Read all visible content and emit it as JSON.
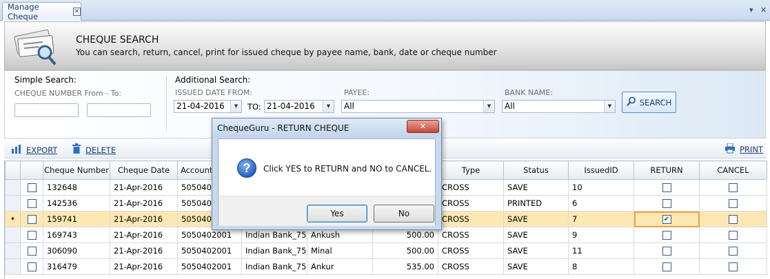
{
  "tab": {
    "title": "Manage Cheque",
    "close_glyph": "✕"
  },
  "window_controls": {
    "dropdown": "▾",
    "close": "✕"
  },
  "header": {
    "title": "CHEQUE SEARCH",
    "subtitle": "You can search, return, cancel, print for issued cheque by payee name, bank, date or cheque number",
    "icon": "cheque-search-icon"
  },
  "search": {
    "simple_label": "Simple Search:",
    "cheque_range_label": "CHEQUE NUMBER From - To:",
    "cheque_from": "",
    "cheque_to": "",
    "additional_label": "Additional Search:",
    "issued_from_label": "ISSUED DATE FROM:",
    "issued_from": "21-04-2016",
    "to_label": "TO:",
    "issued_to": "21-04-2016",
    "payee_label": "PAYEE:",
    "payee_value": "All",
    "bank_label": "BANK NAME:",
    "bank_value": "All",
    "search_button": "SEARCH"
  },
  "toolbar": {
    "export": "EXPORT",
    "delete": "DELETE",
    "print": "PRINT"
  },
  "grid": {
    "columns": [
      "Cheque Number",
      "Cheque Date",
      "Account N",
      "",
      "",
      "",
      "Type",
      "Status",
      "IssuedID",
      "RETURN",
      "CANCEL"
    ],
    "rows": [
      {
        "cheque": "132648",
        "date": "21-Apr-2016",
        "account": "505040200",
        "bank": "",
        "payee": "",
        "amount": "",
        "type": "CROSS",
        "status": "SAVE",
        "issued": "10",
        "ret": false,
        "can": false,
        "selected": false
      },
      {
        "cheque": "142536",
        "date": "21-Apr-2016",
        "account": "505040200",
        "bank": "",
        "payee": "",
        "amount": "",
        "type": "CROSS",
        "status": "PRINTED",
        "issued": "6",
        "ret": false,
        "can": false,
        "selected": false
      },
      {
        "cheque": "159741",
        "date": "21-Apr-2016",
        "account": "505040200",
        "bank": "",
        "payee": "",
        "amount": "",
        "type": "CROSS",
        "status": "SAVE",
        "issued": "7",
        "ret": true,
        "can": false,
        "selected": true
      },
      {
        "cheque": "169743",
        "date": "21-Apr-2016",
        "account": "5050402001",
        "bank": "Indian Bank_75...",
        "payee": "Ankush",
        "amount": "500.00",
        "type": "CROSS",
        "status": "SAVE",
        "issued": "9",
        "ret": false,
        "can": false,
        "selected": false
      },
      {
        "cheque": "306090",
        "date": "21-Apr-2016",
        "account": "5050402001",
        "bank": "Indian Bank_75...",
        "payee": "Minal",
        "amount": "500.00",
        "type": "CROSS",
        "status": "SAVE",
        "issued": "11",
        "ret": false,
        "can": false,
        "selected": false
      },
      {
        "cheque": "316479",
        "date": "21-Apr-2016",
        "account": "5050402001",
        "bank": "Indian Bank_75...",
        "payee": "Ankur",
        "amount": "535.00",
        "type": "CROSS",
        "status": "SAVE",
        "issued": "8",
        "ret": false,
        "can": false,
        "selected": false
      }
    ]
  },
  "dialog": {
    "title": "ChequeGuru - RETURN CHEQUE",
    "message": "Click YES to RETURN and NO to CANCEL.",
    "yes": "Yes",
    "no": "No",
    "close_glyph": "✕",
    "icon": "question-icon"
  },
  "colors": {
    "selected_row": "#fde7b2",
    "accent": "#1d3e72",
    "dialog_frame": "#c9d9ec"
  }
}
